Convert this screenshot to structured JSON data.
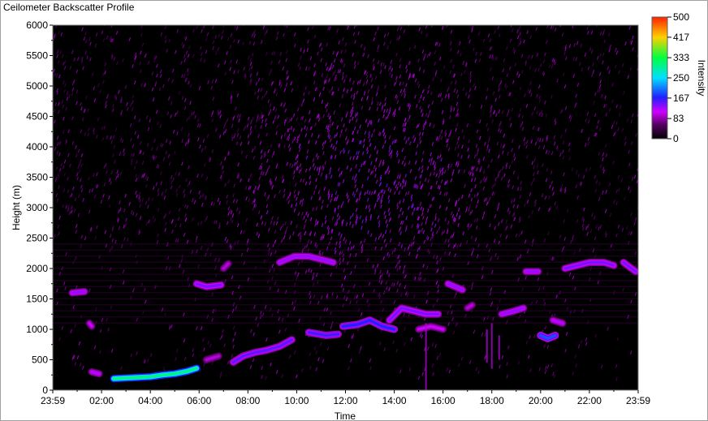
{
  "window": {
    "title": "Ceilometer Backscatter Profile"
  },
  "chart_data": {
    "type": "heatmap",
    "title": "Ceilometer Backscatter Profile",
    "xlabel": "Time",
    "ylabel": "Height (m)",
    "x_tick_labels": [
      "23:59",
      "02:00",
      "04:00",
      "06:00",
      "08:00",
      "10:00",
      "12:00",
      "14:00",
      "16:00",
      "18:00",
      "20:00",
      "22:00",
      "23:59"
    ],
    "x_tick_hours": [
      0,
      2,
      4,
      6,
      8,
      10,
      12,
      14,
      16,
      18,
      20,
      22,
      24
    ],
    "xlim_hours": [
      0,
      24
    ],
    "y_ticks": [
      0,
      500,
      1000,
      1500,
      2000,
      2500,
      3000,
      3500,
      4000,
      4500,
      5000,
      5500,
      6000
    ],
    "ylim": [
      0,
      6000
    ],
    "colorbar": {
      "label": "Intensity",
      "ticks": [
        500,
        417,
        333,
        250,
        167,
        83,
        0
      ],
      "range": [
        0,
        500
      ],
      "stops": [
        {
          "v": 0,
          "color": "#000000"
        },
        {
          "v": 60,
          "color": "#5a0066"
        },
        {
          "v": 110,
          "color": "#d000ff"
        },
        {
          "v": 170,
          "color": "#2020ff"
        },
        {
          "v": 250,
          "color": "#00e0ff"
        },
        {
          "v": 333,
          "color": "#00ff40"
        },
        {
          "v": 417,
          "color": "#ffd000"
        },
        {
          "v": 500,
          "color": "#ff2000"
        }
      ]
    },
    "cloud_layers": [
      {
        "points": [
          [
            0.8,
            1600
          ],
          [
            1.3,
            1620
          ]
        ],
        "intensity": 130
      },
      {
        "points": [
          [
            1.5,
            1100
          ],
          [
            1.6,
            1050
          ]
        ],
        "intensity": 110
      },
      {
        "points": [
          [
            1.6,
            300
          ],
          [
            1.9,
            270
          ]
        ],
        "intensity": 120
      },
      {
        "points": [
          [
            2.5,
            190
          ],
          [
            3.0,
            200
          ],
          [
            3.5,
            210
          ],
          [
            4.0,
            220
          ],
          [
            4.5,
            250
          ],
          [
            5.0,
            270
          ],
          [
            5.5,
            310
          ],
          [
            5.9,
            360
          ]
        ],
        "intensity": 310
      },
      {
        "points": [
          [
            5.9,
            1750
          ],
          [
            6.3,
            1700
          ],
          [
            6.9,
            1730
          ]
        ],
        "intensity": 140
      },
      {
        "points": [
          [
            7.0,
            2000
          ],
          [
            7.2,
            2080
          ]
        ],
        "intensity": 100
      },
      {
        "points": [
          [
            6.3,
            500
          ],
          [
            6.8,
            560
          ]
        ],
        "intensity": 100
      },
      {
        "points": [
          [
            7.4,
            460
          ],
          [
            7.8,
            560
          ],
          [
            8.3,
            620
          ],
          [
            8.8,
            660
          ],
          [
            9.3,
            720
          ],
          [
            9.8,
            830
          ]
        ],
        "intensity": 150
      },
      {
        "points": [
          [
            9.3,
            2100
          ],
          [
            9.9,
            2200
          ],
          [
            10.5,
            2200
          ],
          [
            11.0,
            2150
          ],
          [
            11.5,
            2100
          ]
        ],
        "intensity": 130
      },
      {
        "points": [
          [
            10.5,
            950
          ],
          [
            11.2,
            900
          ],
          [
            11.7,
            920
          ]
        ],
        "intensity": 160
      },
      {
        "points": [
          [
            11.9,
            1050
          ],
          [
            12.5,
            1080
          ],
          [
            13.0,
            1150
          ],
          [
            13.5,
            1050
          ],
          [
            14.0,
            1000
          ]
        ],
        "intensity": 170
      },
      {
        "points": [
          [
            13.8,
            1150
          ],
          [
            14.3,
            1350
          ],
          [
            14.8,
            1300
          ],
          [
            15.3,
            1250
          ],
          [
            15.8,
            1250
          ]
        ],
        "intensity": 140
      },
      {
        "points": [
          [
            15.0,
            1000
          ],
          [
            15.5,
            1050
          ],
          [
            16.0,
            1000
          ]
        ],
        "intensity": 110
      },
      {
        "points": [
          [
            16.2,
            1750
          ],
          [
            16.5,
            1700
          ],
          [
            16.8,
            1650
          ]
        ],
        "intensity": 130
      },
      {
        "points": [
          [
            17.0,
            1350
          ],
          [
            17.2,
            1400
          ]
        ],
        "intensity": 100
      },
      {
        "points": [
          [
            18.4,
            1250
          ],
          [
            18.9,
            1300
          ],
          [
            19.3,
            1350
          ]
        ],
        "intensity": 130
      },
      {
        "points": [
          [
            19.4,
            1950
          ],
          [
            19.9,
            1950
          ]
        ],
        "intensity": 130
      },
      {
        "points": [
          [
            20.0,
            900
          ],
          [
            20.3,
            850
          ],
          [
            20.6,
            900
          ]
        ],
        "intensity": 190
      },
      {
        "points": [
          [
            20.5,
            1150
          ],
          [
            20.9,
            1100
          ]
        ],
        "intensity": 120
      },
      {
        "points": [
          [
            21.0,
            2000
          ],
          [
            21.5,
            2050
          ],
          [
            22.0,
            2100
          ],
          [
            22.6,
            2100
          ],
          [
            23.0,
            2050
          ]
        ],
        "intensity": 140
      },
      {
        "points": [
          [
            23.4,
            2100
          ],
          [
            23.9,
            1950
          ]
        ],
        "intensity": 140
      }
    ],
    "rain_streaks": [
      {
        "x": 15.3,
        "y_top": 1100,
        "y_bottom": 0
      },
      {
        "x": 17.8,
        "y_top": 1000,
        "y_bottom": 450
      },
      {
        "x": 18.0,
        "y_top": 1100,
        "y_bottom": 350
      },
      {
        "x": 18.3,
        "y_top": 900,
        "y_bottom": 500
      }
    ]
  }
}
